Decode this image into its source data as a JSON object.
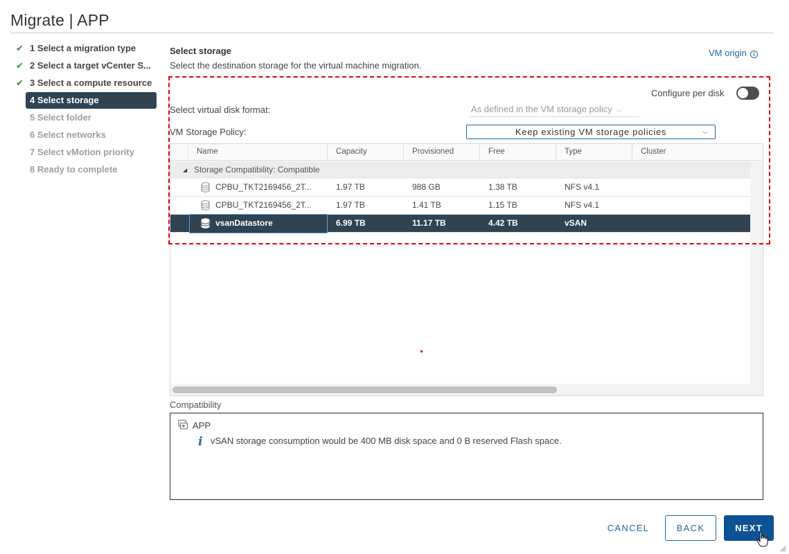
{
  "window": {
    "title": "Migrate | APP"
  },
  "steps": [
    {
      "label": "1 Select a migration type",
      "state": "done",
      "icon": "check-icon"
    },
    {
      "label": "2 Select a target vCenter S...",
      "state": "done",
      "icon": "check-icon"
    },
    {
      "label": "3 Select a compute resource",
      "state": "done",
      "icon": "check-icon"
    },
    {
      "label": "4 Select storage",
      "state": "active"
    },
    {
      "label": "5 Select folder",
      "state": "todo"
    },
    {
      "label": "6 Select networks",
      "state": "todo"
    },
    {
      "label": "7 Select vMotion priority",
      "state": "todo"
    },
    {
      "label": "8 Ready to complete",
      "state": "todo"
    }
  ],
  "section": {
    "title": "Select storage",
    "description": "Select the destination storage for the virtual machine migration.",
    "vm_origin_link": "VM origin"
  },
  "configure_per_disk": {
    "label": "Configure per disk",
    "enabled": false
  },
  "disk_format": {
    "label": "Select virtual disk format:",
    "value": "As defined in the VM storage policy"
  },
  "storage_policy": {
    "label": "VM Storage Policy:",
    "value": "Keep existing VM storage policies"
  },
  "grid": {
    "columns": [
      "Name",
      "Capacity",
      "Provisioned",
      "Free",
      "Type",
      "Cluster"
    ],
    "group_label": "Storage Compatibility: Compatible",
    "rows": [
      {
        "name": "CPBU_TKT2169456_2T...",
        "capacity": "1.97 TB",
        "provisioned": "988 GB",
        "free": "1.38 TB",
        "type": "NFS v4.1",
        "cluster": "",
        "selected": false
      },
      {
        "name": "CPBU_TKT2169456_2T...",
        "capacity": "1.97 TB",
        "provisioned": "1.41 TB",
        "free": "1.15 TB",
        "type": "NFS v4.1",
        "cluster": "",
        "selected": false
      },
      {
        "name": "vsanDatastore",
        "capacity": "6.99 TB",
        "provisioned": "11.17 TB",
        "free": "4.42 TB",
        "type": "vSAN",
        "cluster": "",
        "selected": true
      }
    ]
  },
  "compatibility": {
    "label": "Compatibility",
    "vm_name": "APP",
    "message": "vSAN storage consumption would be 400 MB disk space and 0 B reserved Flash space."
  },
  "buttons": {
    "cancel": "CANCEL",
    "back": "BACK",
    "next": "NEXT"
  },
  "colors": {
    "accent": "#1b6aa5",
    "primary_button": "#0d5294",
    "selection": "#2f4352",
    "check": "#3b8a37",
    "highlight_box": "#e00000"
  }
}
